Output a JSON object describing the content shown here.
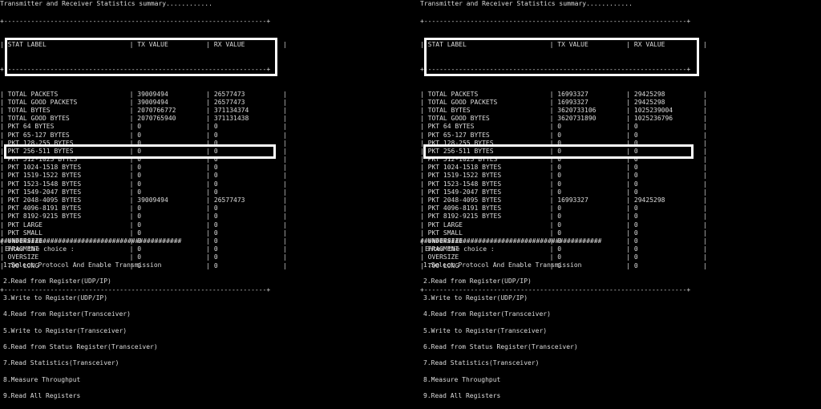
{
  "left": {
    "title": "Transmitter and Receiver Statistics summary............",
    "border": "+--------------------------------------------------------------------+",
    "header": {
      "label": "STAT LABEL",
      "tx": "TX VALUE",
      "rx": "RX VALUE"
    },
    "rows": [
      [
        "TOTAL PACKETS",
        "39009494",
        "26577473"
      ],
      [
        "TOTAL GOOD PACKETS",
        "39009494",
        "26577473"
      ],
      [
        "TOTAL BYTES",
        "2070766772",
        "371134374"
      ],
      [
        "TOTAL GOOD BYTES",
        "2070765940",
        "371131438"
      ],
      [
        "PKT 64 BYTES",
        "0",
        "0"
      ],
      [
        "PKT 65-127 BYTES",
        "0",
        "0"
      ],
      [
        "PKT 128-255 BYTES",
        "0",
        "0"
      ],
      [
        "PKT 256-511 BYTES",
        "0",
        "0"
      ],
      [
        "PKT 512-1023 BYTES",
        "0",
        "0"
      ],
      [
        "PKT 1024-1518 BYTES",
        "0",
        "0"
      ],
      [
        "PKT 1519-1522 BYTES",
        "0",
        "0"
      ],
      [
        "PKT 1523-1548 BYTES",
        "0",
        "0"
      ],
      [
        "PKT 1549-2047 BYTES",
        "0",
        "0"
      ],
      [
        "PKT 2048-4095 BYTES",
        "39009494",
        "26577473"
      ],
      [
        "PKT 4096-8191 BYTES",
        "0",
        "0"
      ],
      [
        "PKT 8192-9215 BYTES",
        "0",
        "0"
      ],
      [
        "PKT LARGE",
        "0",
        "0"
      ],
      [
        "PKT SMALL",
        "0",
        "0"
      ],
      [
        "UNDERSIZE",
        "0",
        "0"
      ],
      [
        "FRAGMENT",
        "0",
        "0"
      ],
      [
        "OVERSIZE",
        "0",
        "0"
      ],
      [
        "TOO LONG",
        "0",
        "0"
      ]
    ],
    "hash_line": "###############################################",
    "menu_header": "Enter the choice :",
    "menu": [
      "1.Select Protocol And Enable Transmission",
      "2.Read from Register(UDP/IP)",
      "3.Write to Register(UDP/IP)",
      "4.Read from Register(Transceiver)",
      "5.Write to Register(Transceiver)",
      "6.Read from Status Register(Transceiver)",
      "7.Read Statistics(Transceiver)",
      "8.Measure Throughput",
      "9.Read All Registers"
    ]
  },
  "right": {
    "title": "Transmitter and Receiver Statistics summary............",
    "border": "+--------------------------------------------------------------------+",
    "header": {
      "label": "STAT LABEL",
      "tx": "TX VALUE",
      "rx": "RX VALUE"
    },
    "rows": [
      [
        "TOTAL PACKETS",
        "16993327",
        "29425298"
      ],
      [
        "TOTAL GOOD PACKETS",
        "16993327",
        "29425298"
      ],
      [
        "TOTAL BYTES",
        "3620733106",
        "1025239004"
      ],
      [
        "TOTAL GOOD BYTES",
        "3620731890",
        "1025236796"
      ],
      [
        "PKT 64 BYTES",
        "0",
        "0"
      ],
      [
        "PKT 65-127 BYTES",
        "0",
        "0"
      ],
      [
        "PKT 128-255 BYTES",
        "0",
        "0"
      ],
      [
        "PKT 256-511 BYTES",
        "0",
        "0"
      ],
      [
        "PKT 512-1023 BYTES",
        "0",
        "0"
      ],
      [
        "PKT 1024-1518 BYTES",
        "0",
        "0"
      ],
      [
        "PKT 1519-1522 BYTES",
        "0",
        "0"
      ],
      [
        "PKT 1523-1548 BYTES",
        "0",
        "0"
      ],
      [
        "PKT 1549-2047 BYTES",
        "0",
        "0"
      ],
      [
        "PKT 2048-4095 BYTES",
        "16993327",
        "29425298"
      ],
      [
        "PKT 4096-8191 BYTES",
        "0",
        "0"
      ],
      [
        "PKT 8192-9215 BYTES",
        "0",
        "0"
      ],
      [
        "PKT LARGE",
        "0",
        "0"
      ],
      [
        "PKT SMALL",
        "0",
        "0"
      ],
      [
        "UNDERSIZE",
        "0",
        "0"
      ],
      [
        "FRAGMENT",
        "0",
        "0"
      ],
      [
        "OVERSIZE",
        "0",
        "0"
      ],
      [
        "TOO LONG",
        "0",
        "0"
      ]
    ],
    "hash_line": "###############################################",
    "menu_header": "Enter the choice :",
    "menu": [
      "1.Select Protocol And Enable Transmission",
      "2.Read from Register(UDP/IP)",
      "3.Write to Register(UDP/IP)",
      "4.Read from Register(Transceiver)",
      "5.Write to Register(Transceiver)",
      "6.Read from Status Register(Transceiver)",
      "7.Read Statistics(Transceiver)",
      "8.Measure Throughput",
      "9.Read All Registers"
    ]
  },
  "colors": {
    "background": "#000000",
    "text": "#dcdcdc",
    "highlight_box": "#ffffff"
  }
}
